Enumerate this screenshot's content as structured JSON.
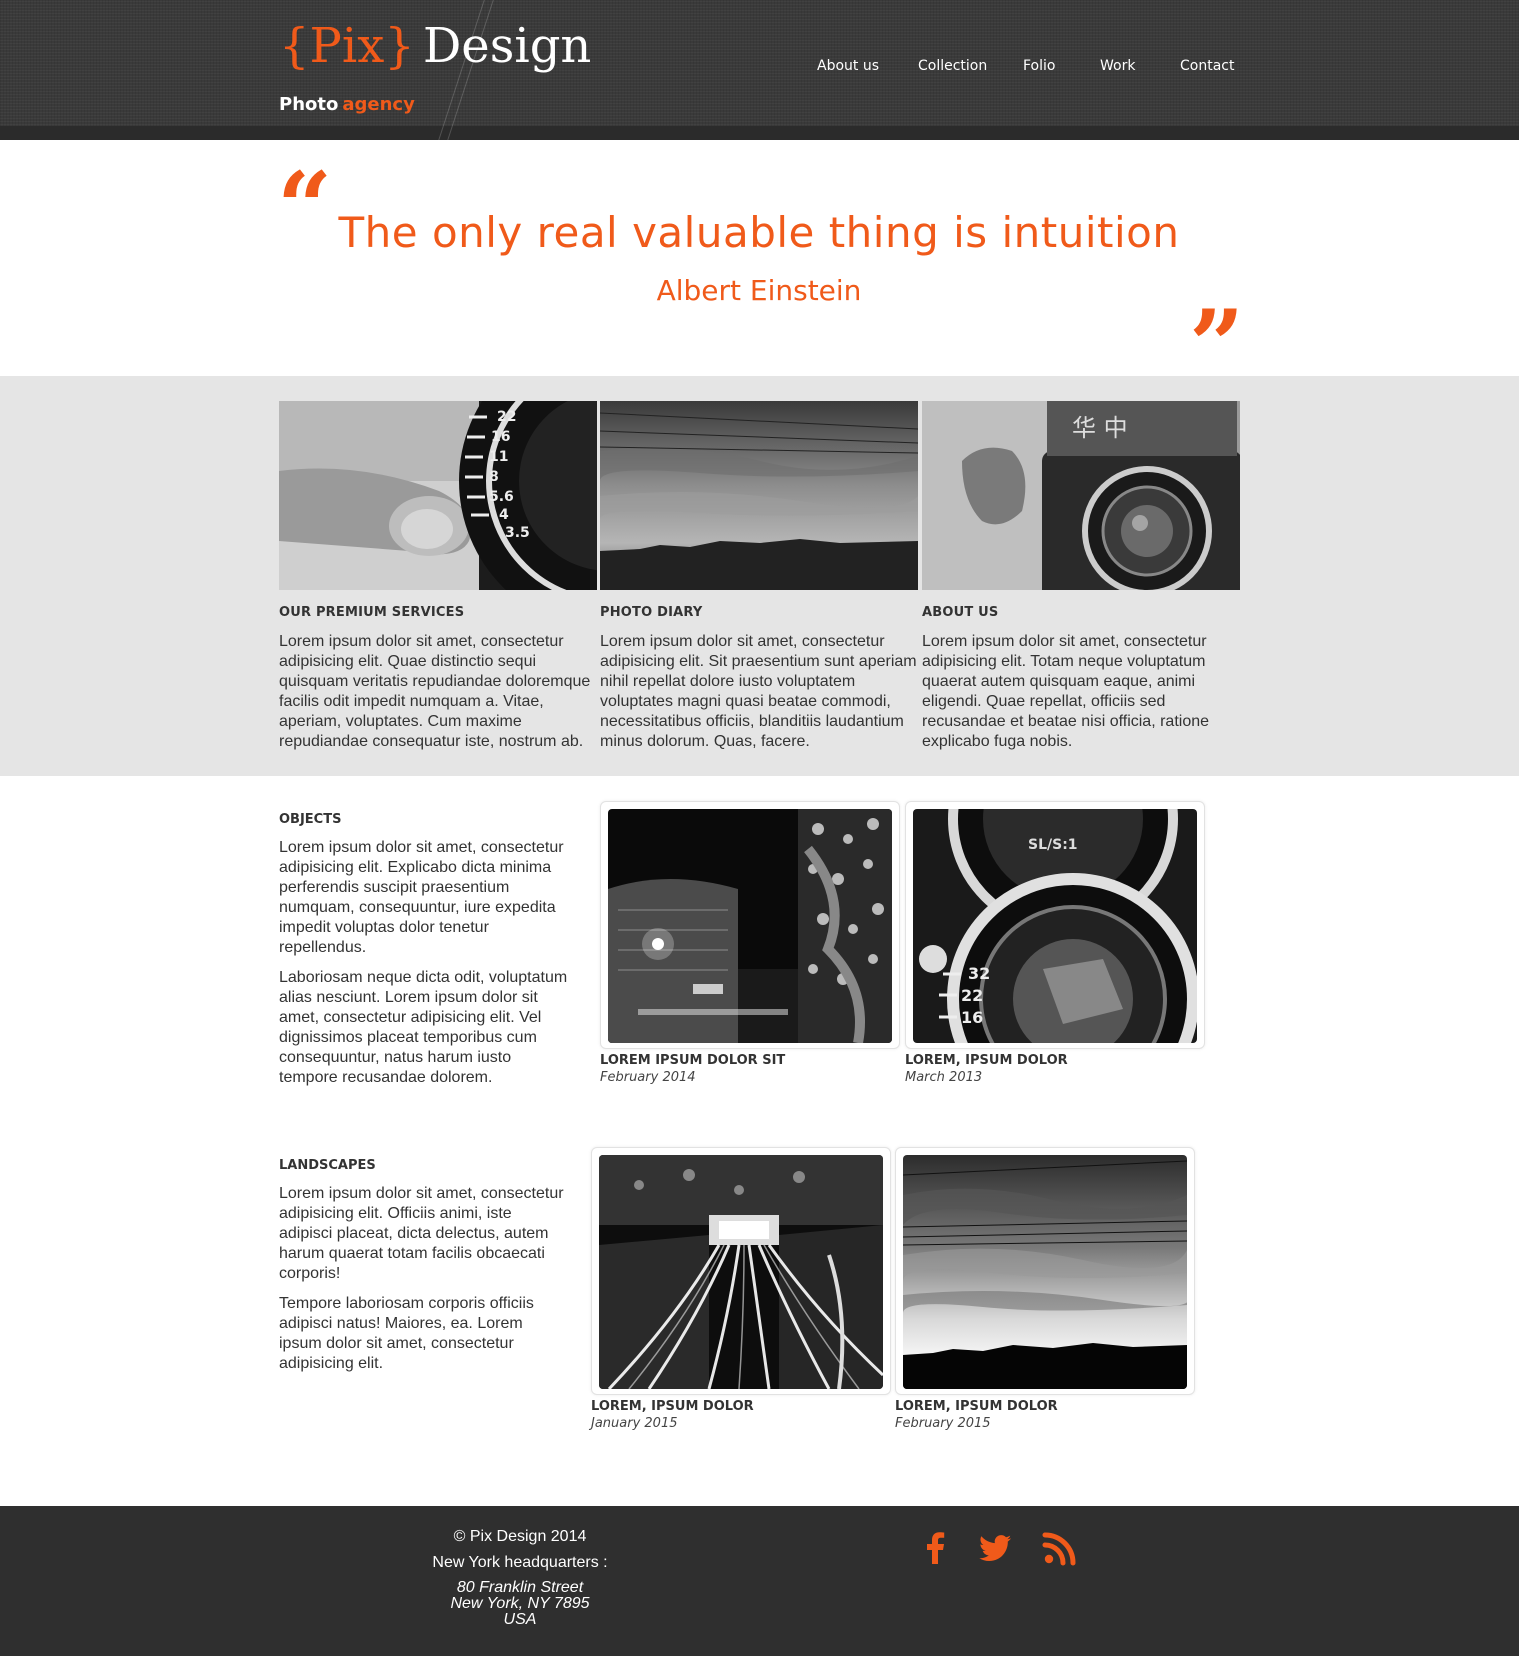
{
  "header": {
    "logo": {
      "brace_open": "{",
      "pix": "Pix",
      "brace_close": "}",
      "design": "Design"
    },
    "tagline": {
      "photo": "Photo",
      "agency": "agency"
    },
    "nav": [
      {
        "label": "About us"
      },
      {
        "label": "Collection"
      },
      {
        "label": "Folio"
      },
      {
        "label": "Work"
      },
      {
        "label": "Contact"
      }
    ]
  },
  "quote": {
    "open_mark": "“",
    "close_mark": "”",
    "text": "The only real valuable thing is intuition",
    "author": "Albert Einstein"
  },
  "features": [
    {
      "title": "OUR PREMIUM SERVICES",
      "text": "Lorem ipsum dolor sit amet, consectetur adipisicing elit. Quae distinctio sequi quisquam veritatis repudiandae doloremque facilis odit impedit numquam a. Vitae, aperiam, voluptates. Cum maxime repudiandae consequatur iste, nostrum ab."
    },
    {
      "title": "PHOTO DIARY",
      "text": "Lorem ipsum dolor sit amet, consectetur adipisicing elit. Sit praesentium sunt aperiam nihil repellat dolore iusto voluptatem voluptates magni quasi beatae commodi, necessitatibus officiis, blanditiis laudantium minus dolorum. Quas, facere."
    },
    {
      "title": "ABOUT US",
      "text": "Lorem ipsum dolor sit amet, consectetur adipisicing elit. Totam neque voluptatum quaerat autem quisquam eaque, animi eligendi. Quae repellat, officiis sed recusandae et beatae nisi officia, ratione explicabo fuga nobis."
    }
  ],
  "objects": {
    "title": "OBJECTS",
    "paragraphs": [
      "Lorem ipsum dolor sit amet, consectetur adipisicing elit. Explicabo dicta minima perferendis suscipit praesentium numquam, consequuntur, iure expedita impedit voluptas dolor tenetur repellendus.",
      "Laboriosam neque dicta odit, voluptatum alias nesciunt. Lorem ipsum dolor sit amet, consectetur adipisicing elit. Vel dignissimos placeat temporibus cum consequuntur, natus harum iusto tempore recusandae dolorem."
    ],
    "cards": [
      {
        "title": "LOREM IPSUM DOLOR SIT",
        "date": "February 2014"
      },
      {
        "title": "LOREM, IPSUM DOLOR",
        "date": "March 2013"
      }
    ]
  },
  "landscapes": {
    "title": "LANDSCAPES",
    "paragraphs": [
      "Lorem ipsum dolor sit amet, consectetur adipisicing elit. Officiis animi, iste adipisci placeat, dicta delectus, autem harum quaerat totam facilis obcaecati corporis!",
      "Tempore laboriosam corporis officiis adipisci natus! Maiores, ea. Lorem ipsum dolor sit amet, consectetur adipisicing elit."
    ],
    "cards": [
      {
        "title": "LOREM, IPSUM DOLOR",
        "date": "January 2015"
      },
      {
        "title": "LOREM, IPSUM DOLOR",
        "date": "February 2015"
      }
    ]
  },
  "footer": {
    "copyright": "© Pix Design 2014",
    "hq": "New York headquarters :",
    "address": [
      "80 Franklin Street",
      "New York, NY 7895",
      "USA"
    ],
    "social": [
      {
        "icon": "facebook-icon"
      },
      {
        "icon": "twitter-icon"
      },
      {
        "icon": "rss-icon"
      }
    ]
  },
  "colors": {
    "accent": "#f05a1a",
    "header_bg": "#3a3a3a",
    "grey_bg": "#e5e5e5",
    "footer_bg": "#2f2f2f"
  }
}
